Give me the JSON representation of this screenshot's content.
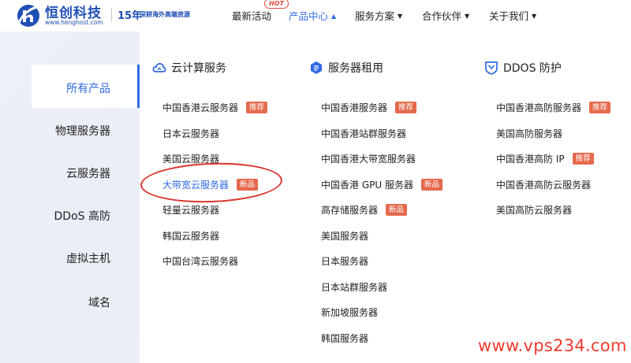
{
  "header": {
    "logo_name": "恒创科技",
    "logo_url": "www.henghost.com",
    "slogan_years": "15年",
    "slogan_text": "深耕海外高端资源",
    "nav": [
      {
        "label": "最新活动",
        "badge": "HOT"
      },
      {
        "label": "产品中心"
      },
      {
        "label": "服务方案"
      },
      {
        "label": "合作伙伴"
      },
      {
        "label": "关于我们"
      }
    ]
  },
  "sidebar": {
    "items": [
      {
        "label": "所有产品"
      },
      {
        "label": "物理服务器"
      },
      {
        "label": "云服务器"
      },
      {
        "label": "DDoS 高防"
      },
      {
        "label": "虚拟主机"
      },
      {
        "label": "域名"
      }
    ]
  },
  "columns": [
    {
      "title": "云计算服务",
      "icon": "cloud-icon",
      "items": [
        {
          "label": "中国香港云服务器",
          "tag": "推荐"
        },
        {
          "label": "日本云服务器"
        },
        {
          "label": "美国云服务器"
        },
        {
          "label": "大带宽云服务器",
          "tag": "新品"
        },
        {
          "label": "轻量云服务器"
        },
        {
          "label": "韩国云服务器"
        },
        {
          "label": "中国台湾云服务器"
        }
      ]
    },
    {
      "title": "服务器租用",
      "icon": "server-icon",
      "items": [
        {
          "label": "中国香港服务器",
          "tag": "推荐"
        },
        {
          "label": "中国香港站群服务器"
        },
        {
          "label": "中国香港大带宽服务器"
        },
        {
          "label": "中国香港 GPU 服务器",
          "tag": "新品"
        },
        {
          "label": "高存储服务器",
          "tag": "新品"
        },
        {
          "label": "美国服务器"
        },
        {
          "label": "日本服务器"
        },
        {
          "label": "日本站群服务器"
        },
        {
          "label": "新加坡服务器"
        },
        {
          "label": "韩国服务器"
        }
      ]
    },
    {
      "title": "DDOS 防护",
      "icon": "shield-icon",
      "items": [
        {
          "label": "中国香港高防服务器",
          "tag": "推荐"
        },
        {
          "label": "美国高防服务器"
        },
        {
          "label": "中国香港高防 IP",
          "tag": "推荐"
        },
        {
          "label": "中国香港高防云服务器"
        },
        {
          "label": "美国高防云服务器"
        }
      ]
    }
  ],
  "watermark": "www.vps234.com",
  "colors": {
    "brand": "#1f4fb5",
    "accent": "#2f6ae4",
    "tag": "#e56a4c",
    "annotation": "#d9322b",
    "watermark": "#ef3a2e"
  }
}
